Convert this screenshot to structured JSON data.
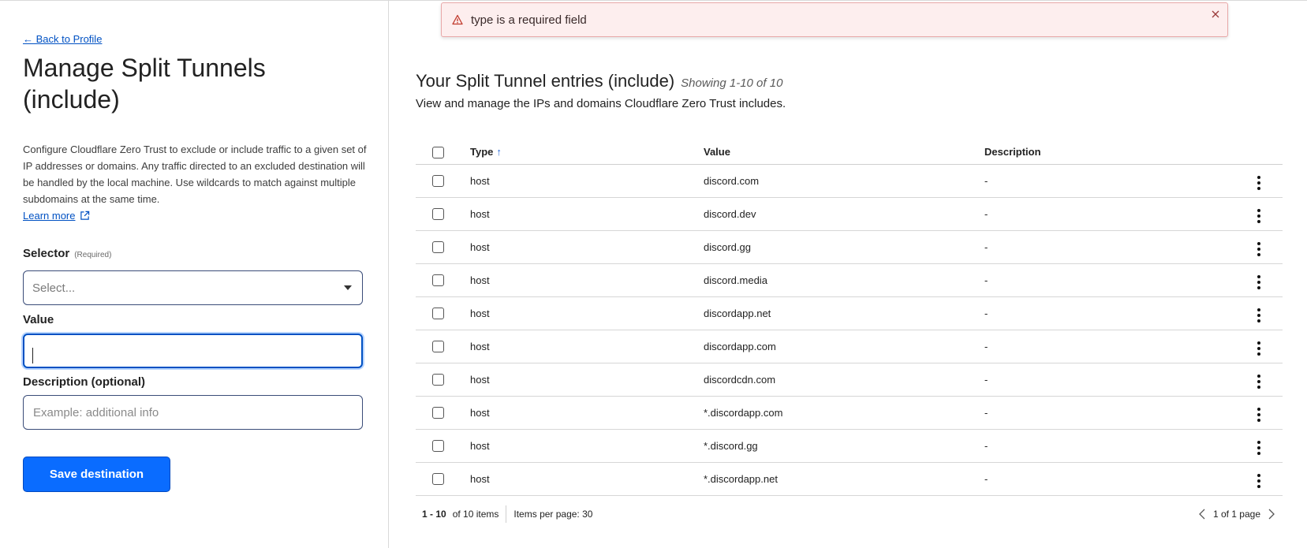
{
  "left": {
    "back_link": "← Back to Profile",
    "title": "Manage Split Tunnels (include)",
    "intro": "Configure Cloudflare Zero Trust to exclude or include traffic to a given set of IP addresses or domains. Any traffic directed to an excluded destination will be handled by the local machine. Use wildcards to match against multiple subdomains at the same time.",
    "learn_more": "Learn more",
    "selector_label": "Selector",
    "selector_required": "(Required)",
    "selector_placeholder": "Select...",
    "value_label": "Value",
    "value_input": "",
    "description_label": "Description (optional)",
    "description_placeholder": "Example: additional info",
    "save_button": "Save destination"
  },
  "toast": {
    "message": "type is a required field",
    "color": "#e8a8a8"
  },
  "right": {
    "title": "Your Split Tunnel entries (include)",
    "showing": "Showing 1-10 of 10",
    "subtitle": "View and manage the IPs and domains Cloudflare Zero Trust includes.",
    "columns": {
      "type": "Type",
      "value": "Value",
      "description": "Description"
    },
    "sort_indicator": "↑",
    "rows": [
      {
        "type": "host",
        "value": "discord.com",
        "description": "-"
      },
      {
        "type": "host",
        "value": "discord.dev",
        "description": "-"
      },
      {
        "type": "host",
        "value": "discord.gg",
        "description": "-"
      },
      {
        "type": "host",
        "value": "discord.media",
        "description": "-"
      },
      {
        "type": "host",
        "value": "discordapp.net",
        "description": "-"
      },
      {
        "type": "host",
        "value": "discordapp.com",
        "description": "-"
      },
      {
        "type": "host",
        "value": "discordcdn.com",
        "description": "-"
      },
      {
        "type": "host",
        "value": "*.discordapp.com",
        "description": "-"
      },
      {
        "type": "host",
        "value": "*.discord.gg",
        "description": "-"
      },
      {
        "type": "host",
        "value": "*.discordapp.net",
        "description": "-"
      }
    ],
    "footer": {
      "range": "1 - 10",
      "of_items": "of 10 items",
      "per_page": "Items per page: 30",
      "page_info": "1 of 1 page"
    }
  },
  "colors": {
    "accent": "#0a6cff",
    "link": "#0051c3"
  }
}
